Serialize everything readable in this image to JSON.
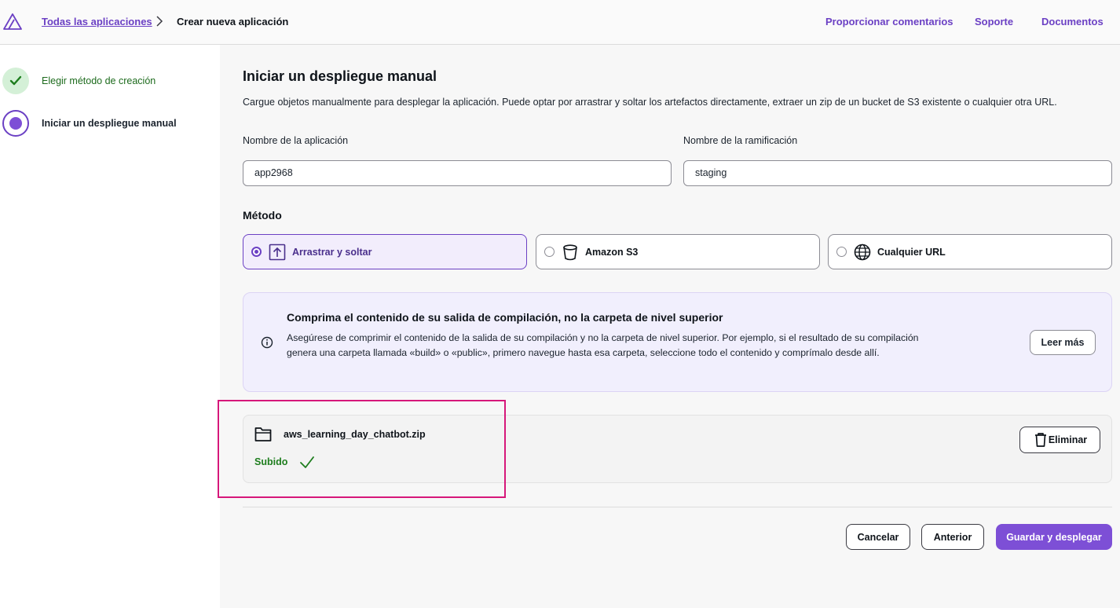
{
  "header": {
    "breadcrumb_link": "Todas las aplicaciones",
    "breadcrumb_current": "Crear nueva aplicación",
    "links": [
      "Proporcionar comentarios",
      "Soporte",
      "Documentos"
    ]
  },
  "sidebar": {
    "steps": [
      {
        "label": "Elegir método de creación",
        "state": "completed"
      },
      {
        "label": "Iniciar un despliegue manual",
        "state": "active"
      }
    ]
  },
  "main": {
    "title": "Iniciar un despliegue manual",
    "description": "Cargue objetos manualmente para desplegar la aplicación. Puede optar por arrastrar y soltar los artefactos directamente, extraer un zip de un bucket de S3 existente o cualquier otra URL.",
    "app_name_label": "Nombre de la aplicación",
    "app_name_value": "app2968",
    "branch_label": "Nombre de la ramificación",
    "branch_value": "staging",
    "method_label": "Método",
    "methods": [
      {
        "label": "Arrastrar y soltar",
        "icon": "upload-icon",
        "selected": true
      },
      {
        "label": "Amazon S3",
        "icon": "bucket-icon",
        "selected": false
      },
      {
        "label": "Cualquier URL",
        "icon": "globe-icon",
        "selected": false
      }
    ],
    "info": {
      "title": "Comprima el contenido de su salida de compilación, no la carpeta de nivel superior",
      "text": "Asegúrese de comprimir el contenido de la salida de su compilación y no la carpeta de nivel superior. Por ejemplo, si el resultado de su compilación genera una carpeta llamada «build» o «public», primero navegue hasta esa carpeta, seleccione todo el contenido y comprímalo desde allí.",
      "button": "Leer más"
    },
    "file": {
      "name": "aws_learning_day_chatbot.zip",
      "status": "Subido",
      "delete_button": "Eliminar"
    },
    "actions": {
      "cancel": "Cancelar",
      "previous": "Anterior",
      "submit": "Guardar y desplegar"
    }
  },
  "colors": {
    "accent": "#7d4fd6",
    "link": "#6b40c4",
    "success": "#1d7d1d",
    "highlight": "#d6177a"
  }
}
